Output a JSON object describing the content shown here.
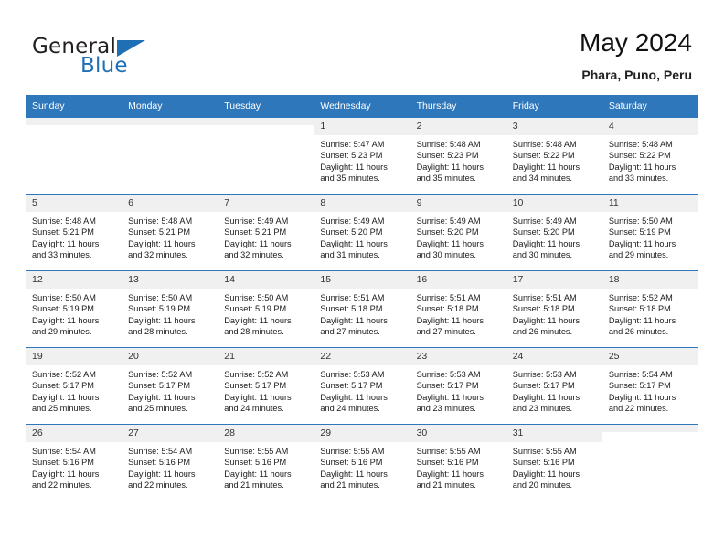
{
  "brand": {
    "name_top": "General",
    "name_bottom": "Blue",
    "triangle_color": "#1f6fb5"
  },
  "header": {
    "title": "May 2024",
    "subtitle": "Phara, Puno, Peru"
  },
  "theme": {
    "header_row_bg": "#2f77bb",
    "daynum_bg": "#f0f0f0",
    "text": "#1a1a1a"
  },
  "weekday_headers": [
    "Sunday",
    "Monday",
    "Tuesday",
    "Wednesday",
    "Thursday",
    "Friday",
    "Saturday"
  ],
  "labels": {
    "sunrise_prefix": "Sunrise:",
    "sunset_prefix": "Sunset:",
    "daylight_prefix": "Daylight:"
  },
  "weeks": [
    [
      {
        "empty": true
      },
      {
        "empty": true
      },
      {
        "empty": true
      },
      {
        "day": "1",
        "sunrise": "Sunrise: 5:47 AM",
        "sunset": "Sunset: 5:23 PM",
        "daylight": "Daylight: 11 hours and 35 minutes."
      },
      {
        "day": "2",
        "sunrise": "Sunrise: 5:48 AM",
        "sunset": "Sunset: 5:23 PM",
        "daylight": "Daylight: 11 hours and 35 minutes."
      },
      {
        "day": "3",
        "sunrise": "Sunrise: 5:48 AM",
        "sunset": "Sunset: 5:22 PM",
        "daylight": "Daylight: 11 hours and 34 minutes."
      },
      {
        "day": "4",
        "sunrise": "Sunrise: 5:48 AM",
        "sunset": "Sunset: 5:22 PM",
        "daylight": "Daylight: 11 hours and 33 minutes."
      }
    ],
    [
      {
        "day": "5",
        "sunrise": "Sunrise: 5:48 AM",
        "sunset": "Sunset: 5:21 PM",
        "daylight": "Daylight: 11 hours and 33 minutes."
      },
      {
        "day": "6",
        "sunrise": "Sunrise: 5:48 AM",
        "sunset": "Sunset: 5:21 PM",
        "daylight": "Daylight: 11 hours and 32 minutes."
      },
      {
        "day": "7",
        "sunrise": "Sunrise: 5:49 AM",
        "sunset": "Sunset: 5:21 PM",
        "daylight": "Daylight: 11 hours and 32 minutes."
      },
      {
        "day": "8",
        "sunrise": "Sunrise: 5:49 AM",
        "sunset": "Sunset: 5:20 PM",
        "daylight": "Daylight: 11 hours and 31 minutes."
      },
      {
        "day": "9",
        "sunrise": "Sunrise: 5:49 AM",
        "sunset": "Sunset: 5:20 PM",
        "daylight": "Daylight: 11 hours and 30 minutes."
      },
      {
        "day": "10",
        "sunrise": "Sunrise: 5:49 AM",
        "sunset": "Sunset: 5:20 PM",
        "daylight": "Daylight: 11 hours and 30 minutes."
      },
      {
        "day": "11",
        "sunrise": "Sunrise: 5:50 AM",
        "sunset": "Sunset: 5:19 PM",
        "daylight": "Daylight: 11 hours and 29 minutes."
      }
    ],
    [
      {
        "day": "12",
        "sunrise": "Sunrise: 5:50 AM",
        "sunset": "Sunset: 5:19 PM",
        "daylight": "Daylight: 11 hours and 29 minutes."
      },
      {
        "day": "13",
        "sunrise": "Sunrise: 5:50 AM",
        "sunset": "Sunset: 5:19 PM",
        "daylight": "Daylight: 11 hours and 28 minutes."
      },
      {
        "day": "14",
        "sunrise": "Sunrise: 5:50 AM",
        "sunset": "Sunset: 5:19 PM",
        "daylight": "Daylight: 11 hours and 28 minutes."
      },
      {
        "day": "15",
        "sunrise": "Sunrise: 5:51 AM",
        "sunset": "Sunset: 5:18 PM",
        "daylight": "Daylight: 11 hours and 27 minutes."
      },
      {
        "day": "16",
        "sunrise": "Sunrise: 5:51 AM",
        "sunset": "Sunset: 5:18 PM",
        "daylight": "Daylight: 11 hours and 27 minutes."
      },
      {
        "day": "17",
        "sunrise": "Sunrise: 5:51 AM",
        "sunset": "Sunset: 5:18 PM",
        "daylight": "Daylight: 11 hours and 26 minutes."
      },
      {
        "day": "18",
        "sunrise": "Sunrise: 5:52 AM",
        "sunset": "Sunset: 5:18 PM",
        "daylight": "Daylight: 11 hours and 26 minutes."
      }
    ],
    [
      {
        "day": "19",
        "sunrise": "Sunrise: 5:52 AM",
        "sunset": "Sunset: 5:17 PM",
        "daylight": "Daylight: 11 hours and 25 minutes."
      },
      {
        "day": "20",
        "sunrise": "Sunrise: 5:52 AM",
        "sunset": "Sunset: 5:17 PM",
        "daylight": "Daylight: 11 hours and 25 minutes."
      },
      {
        "day": "21",
        "sunrise": "Sunrise: 5:52 AM",
        "sunset": "Sunset: 5:17 PM",
        "daylight": "Daylight: 11 hours and 24 minutes."
      },
      {
        "day": "22",
        "sunrise": "Sunrise: 5:53 AM",
        "sunset": "Sunset: 5:17 PM",
        "daylight": "Daylight: 11 hours and 24 minutes."
      },
      {
        "day": "23",
        "sunrise": "Sunrise: 5:53 AM",
        "sunset": "Sunset: 5:17 PM",
        "daylight": "Daylight: 11 hours and 23 minutes."
      },
      {
        "day": "24",
        "sunrise": "Sunrise: 5:53 AM",
        "sunset": "Sunset: 5:17 PM",
        "daylight": "Daylight: 11 hours and 23 minutes."
      },
      {
        "day": "25",
        "sunrise": "Sunrise: 5:54 AM",
        "sunset": "Sunset: 5:17 PM",
        "daylight": "Daylight: 11 hours and 22 minutes."
      }
    ],
    [
      {
        "day": "26",
        "sunrise": "Sunrise: 5:54 AM",
        "sunset": "Sunset: 5:16 PM",
        "daylight": "Daylight: 11 hours and 22 minutes."
      },
      {
        "day": "27",
        "sunrise": "Sunrise: 5:54 AM",
        "sunset": "Sunset: 5:16 PM",
        "daylight": "Daylight: 11 hours and 22 minutes."
      },
      {
        "day": "28",
        "sunrise": "Sunrise: 5:55 AM",
        "sunset": "Sunset: 5:16 PM",
        "daylight": "Daylight: 11 hours and 21 minutes."
      },
      {
        "day": "29",
        "sunrise": "Sunrise: 5:55 AM",
        "sunset": "Sunset: 5:16 PM",
        "daylight": "Daylight: 11 hours and 21 minutes."
      },
      {
        "day": "30",
        "sunrise": "Sunrise: 5:55 AM",
        "sunset": "Sunset: 5:16 PM",
        "daylight": "Daylight: 11 hours and 21 minutes."
      },
      {
        "day": "31",
        "sunrise": "Sunrise: 5:55 AM",
        "sunset": "Sunset: 5:16 PM",
        "daylight": "Daylight: 11 hours and 20 minutes."
      },
      {
        "empty": true
      }
    ]
  ]
}
